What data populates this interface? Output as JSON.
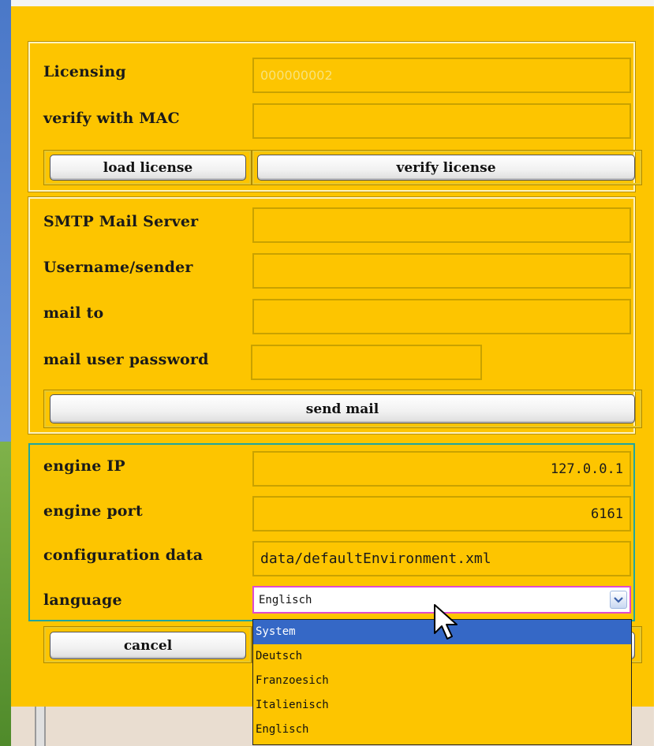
{
  "licensing": {
    "licensing_label": "Licensing",
    "licensing_value": "000000002",
    "verify_mac_label": "verify with MAC",
    "verify_mac_value": "",
    "load_license_button": "load license",
    "verify_license_button": "verify license"
  },
  "mail": {
    "smtp_label": "SMTP Mail Server",
    "smtp_value": "",
    "username_label": "Username/sender",
    "username_value": "",
    "mail_to_label": "mail to",
    "mail_to_value": "",
    "password_label": "mail user password",
    "password_value": "",
    "send_mail_button": "send mail"
  },
  "engine": {
    "ip_label": "engine IP",
    "ip_value": "127.0.0.1",
    "port_label": "engine port",
    "port_value": "6161",
    "config_label": "configuration data",
    "config_value": "data/defaultEnvironment.xml",
    "language_label": "language",
    "language_selected": "Englisch",
    "language_options": [
      "System",
      "Deutsch",
      "Franzoesich",
      "Italienisch",
      "Englisch"
    ],
    "language_highlighted": "System"
  },
  "actions": {
    "cancel_button": "cancel"
  },
  "icons": {
    "combo_arrow": "chevron-down-icon",
    "cursor": "mouse-pointer-icon"
  },
  "colors": {
    "dialog_background": "#fdc500",
    "selection": "#3568c6",
    "engine_border": "#1fa6a0",
    "combo_focus_border": "#e04bd0"
  }
}
